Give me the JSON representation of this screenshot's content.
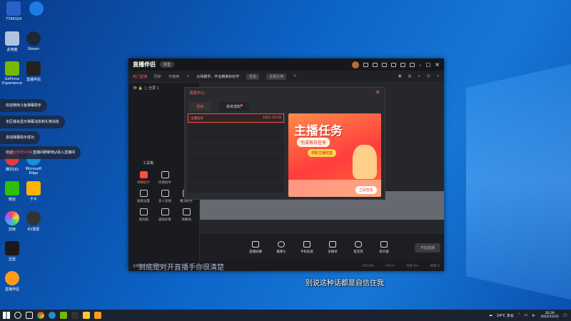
{
  "desktop": {
    "icons": [
      {
        "label": "此电脑"
      },
      {
        "label": "Steam"
      },
      {
        "label": "GeForce Experience"
      },
      {
        "label": "直播伴侣"
      },
      {
        "label": "腾讯QQ"
      },
      {
        "label": "Microsoft Edge"
      },
      {
        "label": "微信"
      },
      {
        "label": "千牛"
      },
      {
        "label": "剪映"
      },
      {
        "label": "EV录屏"
      },
      {
        "label": "迅雷"
      },
      {
        "label": "直播伴侣"
      }
    ],
    "top_left_label": "7794324"
  },
  "notifications": [
    {
      "text": "欢迎使用斗鱼弹幕助手"
    },
    {
      "text": "本区域会显示弹幕消息和礼物消息"
    },
    {
      "text": "添加弹幕助手成功"
    },
    {
      "pre": "欢迎",
      "highlight": "全部佳VIP新",
      "post": "直播间刷新到yl进入直播间"
    }
  ],
  "app": {
    "title": "直播伴侣",
    "badge": "抖音",
    "tabs": [
      "热门直播",
      "同步",
      "可使用"
    ],
    "announcement": "大师教学，毕业精英好好学",
    "announcement_btn": "查看",
    "all_btn": "全部大神",
    "scene_label": "全屏 1",
    "tools_label": "工具箱",
    "tools": [
      {
        "label": "弹幕助手",
        "active": true
      },
      {
        "label": "房管助手",
        "active": false
      },
      {
        "label": "贴纸设置",
        "active": false
      },
      {
        "label": "多人连线",
        "active": false
      },
      {
        "label": "推流助手",
        "active": false
      },
      {
        "label": "道具箱",
        "active": false
      },
      {
        "label": "虚拟形象",
        "active": false
      },
      {
        "label": "弹幕墙",
        "active": false
      }
    ],
    "left_footer": "主播直播伴侣使用教程",
    "bottom_buttons": [
      "直播屏幕",
      "摄像头",
      "手机投屏",
      "多媒体",
      "麦克风",
      "扬声器"
    ],
    "start_btn": "开始直播",
    "status": [
      "CPU:0%",
      "FPS:0",
      "内存:0%",
      "帧率:0"
    ],
    "dialog": {
      "title": "消息中心",
      "tabs": [
        "活动",
        "系统通知"
      ],
      "messages": [
        {
          "title": "主播任务",
          "date": "2022-10-18"
        }
      ],
      "promo_title": "主播任务",
      "promo_sub": "完成每日任务",
      "promo_btn": "领取主播权益",
      "promo_go": "立即查看",
      "close": "×"
    }
  },
  "subtitles": {
    "line1": "到底是对开直播手你很清楚",
    "line2": "别说这种话都是自信住我"
  },
  "taskbar": {
    "weather": "24°C 多云",
    "time": "20:39",
    "date": "2022/10/31"
  }
}
